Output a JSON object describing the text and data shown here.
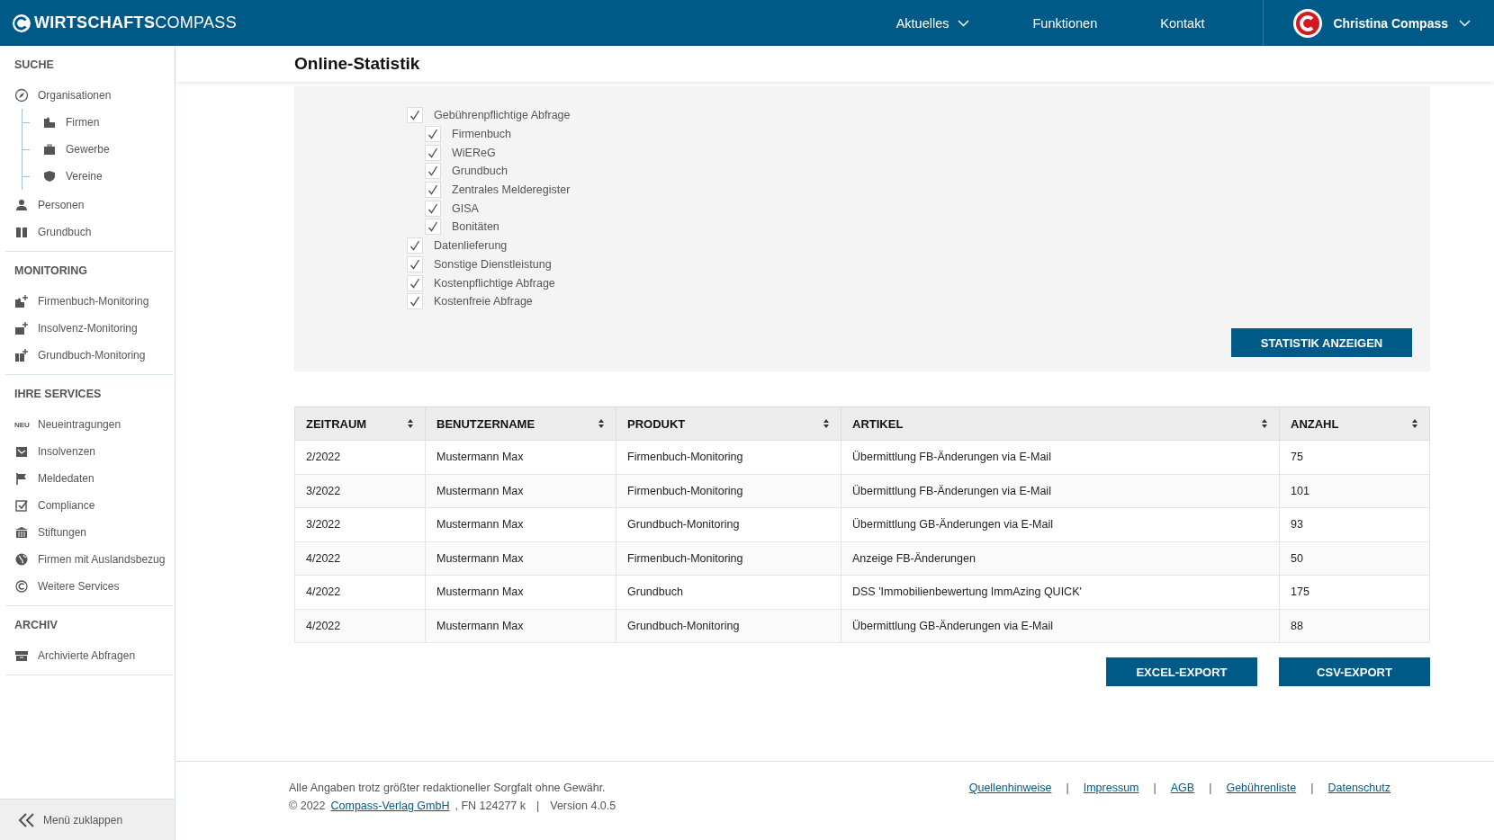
{
  "header": {
    "logo": {
      "bold": "WIRTSCHAFTS",
      "light": "COMPASS"
    },
    "nav": [
      {
        "label": "Aktuelles",
        "dropdown": true
      },
      {
        "label": "Funktionen",
        "dropdown": false
      },
      {
        "label": "Kontakt",
        "dropdown": false
      }
    ],
    "user": {
      "name": "Christina Compass"
    }
  },
  "sidebar": {
    "sections": [
      {
        "title": "SUCHE",
        "items": [
          {
            "label": "Organisationen",
            "children": [
              {
                "label": "Firmen"
              },
              {
                "label": "Gewerbe"
              },
              {
                "label": "Vereine"
              }
            ]
          },
          {
            "label": "Personen"
          },
          {
            "label": "Grundbuch"
          }
        ]
      },
      {
        "title": "MONITORING",
        "items": [
          {
            "label": "Firmenbuch-Monitoring"
          },
          {
            "label": "Insolvenz-Monitoring"
          },
          {
            "label": "Grundbuch-Monitoring"
          }
        ]
      },
      {
        "title": "IHRE SERVICES",
        "items": [
          {
            "label": "Neueintragungen",
            "badge": "NEU"
          },
          {
            "label": "Insolvenzen"
          },
          {
            "label": "Meldedaten"
          },
          {
            "label": "Compliance"
          },
          {
            "label": "Stiftungen"
          },
          {
            "label": "Firmen mit Auslandsbezug"
          },
          {
            "label": "Weitere Services"
          }
        ]
      },
      {
        "title": "ARCHIV",
        "items": [
          {
            "label": "Archivierte Abfragen"
          }
        ]
      }
    ],
    "collapse": "Menü zuklappen"
  },
  "page": {
    "title": "Online-Statistik"
  },
  "filters": [
    {
      "label": "Gebührenpflichtige Abfrage",
      "checked": true,
      "children": [
        {
          "label": "Firmenbuch",
          "checked": true
        },
        {
          "label": "WiEReG",
          "checked": true
        },
        {
          "label": "Grundbuch",
          "checked": true
        },
        {
          "label": "Zentrales Melderegister",
          "checked": true
        },
        {
          "label": "GISA",
          "checked": true
        },
        {
          "label": "Bonitäten",
          "checked": true
        }
      ]
    },
    {
      "label": "Datenlieferung",
      "checked": true
    },
    {
      "label": "Sonstige Dienstleistung",
      "checked": true
    },
    {
      "label": "Kostenpflichtige Abfrage",
      "checked": true
    },
    {
      "label": "Kostenfreie Abfrage",
      "checked": true
    }
  ],
  "show_button": "STATISTIK ANZEIGEN",
  "table": {
    "columns": [
      "ZEITRAUM",
      "BENUTZERNAME",
      "PRODUKT",
      "ARTIKEL",
      "ANZAHL"
    ],
    "rows": [
      [
        "2/2022",
        "Mustermann Max",
        "Firmenbuch-Monitoring",
        "Übermittlung FB-Änderungen via E-Mail",
        "75"
      ],
      [
        "3/2022",
        "Mustermann Max",
        "Firmenbuch-Monitoring",
        "Übermittlung FB-Änderungen via E-Mail",
        "101"
      ],
      [
        "3/2022",
        "Mustermann Max",
        "Grundbuch-Monitoring",
        "Übermittlung GB-Änderungen via E-Mail",
        "93"
      ],
      [
        "4/2022",
        "Mustermann Max",
        "Firmenbuch-Monitoring",
        "Anzeige FB-Änderungen",
        "50"
      ],
      [
        "4/2022",
        "Mustermann Max",
        "Grundbuch",
        "DSS 'Immobilienbewertung ImmAzing QUICK'",
        "175"
      ],
      [
        "4/2022",
        "Mustermann Max",
        "Grundbuch-Monitoring",
        "Übermittlung GB-Änderungen via E-Mail",
        "88"
      ]
    ]
  },
  "export_buttons": [
    "EXCEL-EXPORT",
    "CSV-EXPORT"
  ],
  "footer": {
    "disclaimer": "Alle Angaben trotz größter redaktioneller Sorgfalt ohne Gewähr.",
    "imprint": [
      {
        "kind": "text",
        "text": "© 2022"
      },
      {
        "kind": "link",
        "text": "Compass-Verlag GmbH "
      },
      {
        "kind": "text",
        "text": ", FN 124277 k"
      },
      {
        "kind": "separator",
        "text": "|"
      },
      {
        "kind": "text",
        "text": "Version 4.0.5"
      }
    ],
    "links": [
      {
        "kind": "link",
        "text": "Quellenhinweise"
      },
      {
        "kind": "separator",
        "text": "|"
      },
      {
        "kind": "link",
        "text": "Impressum"
      },
      {
        "kind": "separator",
        "text": "|"
      },
      {
        "kind": "link",
        "text": "AGB"
      },
      {
        "kind": "separator",
        "text": "|"
      },
      {
        "kind": "link",
        "text": "Gebührenliste"
      },
      {
        "kind": "separator",
        "text": "|"
      },
      {
        "kind": "link",
        "text": "Datenschutz"
      }
    ]
  }
}
